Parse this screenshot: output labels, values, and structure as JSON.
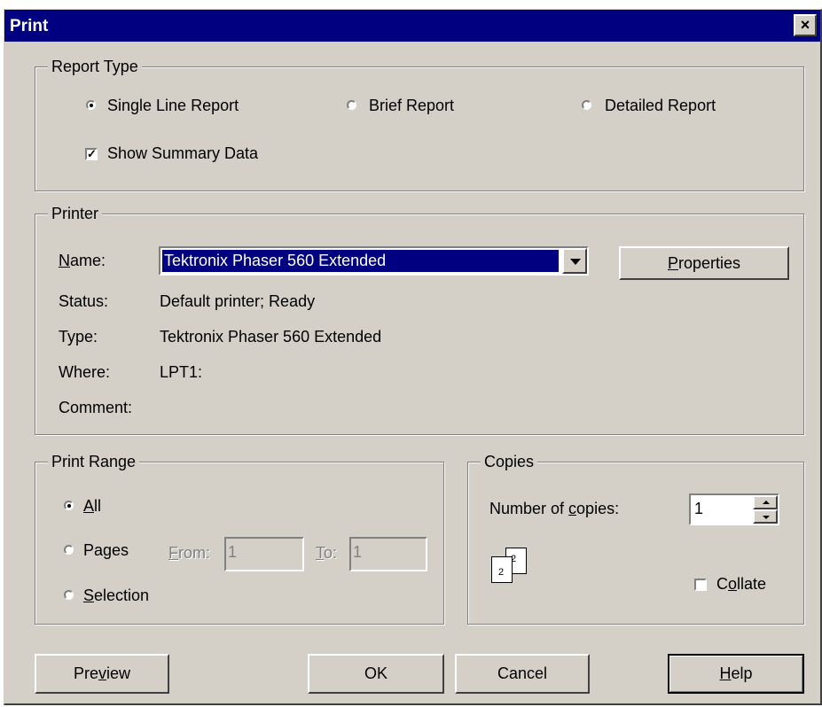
{
  "window": {
    "title": "Print",
    "close_label": "×"
  },
  "report_type": {
    "legend": "Report Type",
    "options": [
      {
        "label": "Single Line Report",
        "selected": true
      },
      {
        "label": "Brief Report",
        "selected": false
      },
      {
        "label": "Detailed Report",
        "selected": false
      }
    ],
    "show_summary": {
      "label": "Show Summary Data",
      "checked": true
    }
  },
  "printer": {
    "legend": "Printer",
    "name_label_mn": "N",
    "name_label_rest": "ame:",
    "name_value": "Tektronix Phaser 560 Extended",
    "properties_mn": "P",
    "properties_rest": "roperties",
    "status_label": "Status:",
    "status_value": "Default printer; Ready",
    "type_label": "Type:",
    "type_value": "Tektronix Phaser 560 Extended",
    "where_label": "Where:",
    "where_value": "LPT1:",
    "comment_label": "Comment:"
  },
  "print_range": {
    "legend": "Print Range",
    "all_mn": "A",
    "all_rest": "ll",
    "all_selected": true,
    "pages_label": "Pages",
    "from_mn": "F",
    "from_rest": "rom:",
    "from_value": "1",
    "to_mn": "T",
    "to_rest": "o:",
    "to_value": "1",
    "selection_mn": "S",
    "selection_rest": "election"
  },
  "copies": {
    "legend": "Copies",
    "num_prefix": "Number of ",
    "num_mn": "c",
    "num_rest": "opies:",
    "num_value": "1",
    "page_icon_labels": [
      "2",
      "2"
    ],
    "collate_prefix": "C",
    "collate_mn": "o",
    "collate_rest": "llate",
    "collate_checked": false
  },
  "buttons": {
    "preview_prefix": "Pre",
    "preview_mn": "v",
    "preview_rest": "iew",
    "ok": "OK",
    "cancel": "Cancel",
    "help_mn": "H",
    "help_rest": "elp"
  }
}
